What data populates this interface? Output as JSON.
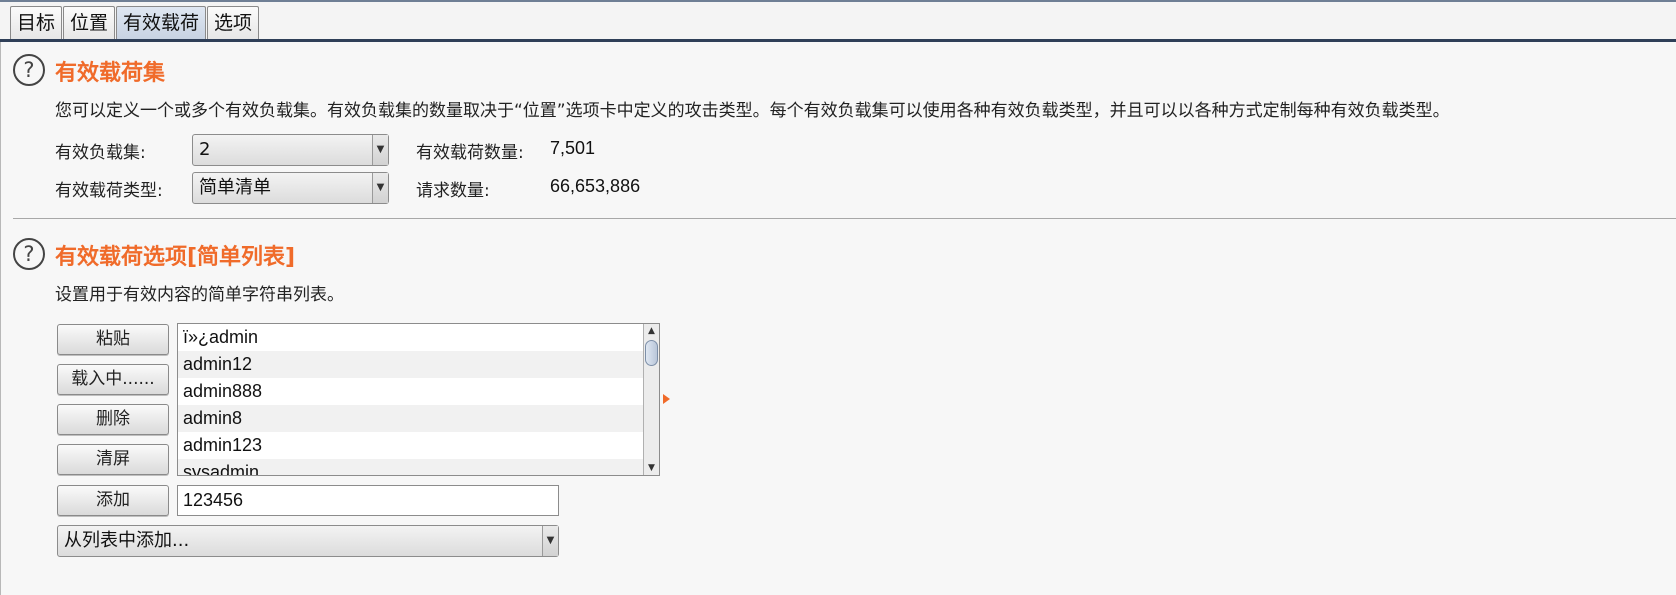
{
  "tabs": [
    {
      "label": "目标",
      "active": false
    },
    {
      "label": "位置",
      "active": false
    },
    {
      "label": "有效载荷",
      "active": true
    },
    {
      "label": "选项",
      "active": false
    }
  ],
  "payload_sets_section": {
    "help_icon": "help-circle-icon",
    "title": "有效载荷集",
    "description": "您可以定义一个或多个有效负载集。有效负载集的数量取决于“位置”选项卡中定义的攻击类型。每个有效负载集可以使用各种有效负载类型，并且可以以各种方式定制每种有效负载类型。",
    "payload_set_label": "有效负载集:",
    "payload_set_value": "2",
    "payload_type_label": "有效载荷类型:",
    "payload_type_value": "简单清单",
    "payload_count_label": "有效载荷数量:",
    "payload_count_value": "7,501",
    "request_count_label": "请求数量:",
    "request_count_value": "66,653,886"
  },
  "payload_options_section": {
    "help_icon": "help-circle-icon",
    "title": "有效载荷选项[简单列表]",
    "description": "设置用于有效内容的简单字符串列表。",
    "buttons": {
      "paste": "粘贴",
      "load": "载入中......",
      "remove": "删除",
      "clear": "清屏",
      "add": "添加"
    },
    "list_items": [
      "ï»¿admin",
      "admin12",
      "admin888",
      "admin8",
      "admin123",
      "sysadmin"
    ],
    "add_input_value": "123456",
    "add_from_list_value": "从列表中添加..."
  },
  "colors": {
    "accent_orange": "#f06b2a",
    "tab_active": "#c7d2e2"
  }
}
